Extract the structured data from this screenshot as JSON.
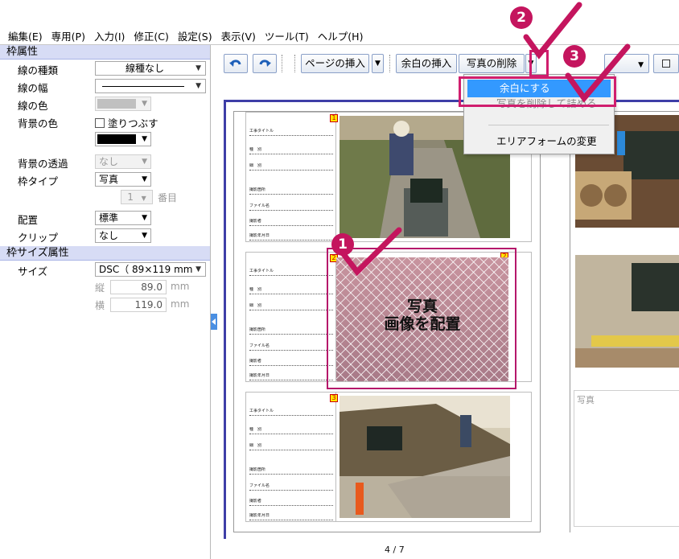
{
  "menubar": [
    {
      "id": "edit",
      "label": "編集(E)"
    },
    {
      "id": "special",
      "label": "専用(P)"
    },
    {
      "id": "input",
      "label": "入力(I)"
    },
    {
      "id": "modify",
      "label": "修正(C)"
    },
    {
      "id": "settings",
      "label": "設定(S)"
    },
    {
      "id": "view",
      "label": "表示(V)"
    },
    {
      "id": "tools",
      "label": "ツール(T)"
    },
    {
      "id": "help",
      "label": "ヘルプ(H)"
    }
  ],
  "frame_props": {
    "header": "枠属性",
    "line_type_label": "線の種類",
    "line_type_value": "線種なし",
    "line_width_label": "線の幅",
    "line_color_label": "線の色",
    "bg_color_label": "背景の色",
    "fill_label": "塗りつぶす",
    "bg_transparency_label": "背景の透過",
    "bg_transparency_value": "なし",
    "frame_type_label": "枠タイプ",
    "frame_type_value": "写真",
    "index_value": "1",
    "index_suffix": "番目",
    "layout_label": "配置",
    "layout_value": "標準",
    "clip_label": "クリップ",
    "clip_value": "なし"
  },
  "size_props": {
    "header": "枠サイズ属性",
    "size_label": "サイズ",
    "size_value": "DSC（ 89×119 mm",
    "height_label": "縦",
    "height_value": "89.0",
    "height_unit": "mm",
    "width_label": "横",
    "width_value": "119.0",
    "width_unit": "mm"
  },
  "toolbar": {
    "insert_page": "ページの挿入",
    "insert_blank": "余白の挿入",
    "delete_photo": "写真の削除"
  },
  "popup": {
    "make_blank": "余白にする",
    "move_photo": "写真を削除して詰める",
    "change_area_form": "エリアフォームの変更"
  },
  "overlay": {
    "line1": "写真",
    "line2": "画像を配置"
  },
  "slots": [
    {
      "num": "1",
      "rows": [
        "工事タイトル",
        "種　別",
        "細　別",
        "撮影箇所",
        "ファイル名",
        "撮影者",
        "撮影年月日"
      ]
    },
    {
      "num": "2",
      "rows": [
        "工事タイトル",
        "種　別",
        "細　別",
        "撮影箇所",
        "ファイル名",
        "撮影者",
        "撮影年月日"
      ]
    },
    {
      "num": "3",
      "rows": [
        "工事タイトル",
        "種　別",
        "細　別",
        "撮影箇所",
        "ファイル名",
        "撮影者",
        "撮影年月日"
      ]
    }
  ],
  "right_page": {
    "empty_slot_label": "写真"
  },
  "callouts": {
    "one": "1",
    "two": "2",
    "three": "3"
  },
  "page_indicator": "4 / 7",
  "colors": {
    "accent": "#c4155e",
    "highlight": "#3399ff",
    "panel_header": "#d7dcf5",
    "frame_border": "#3e3ea7"
  }
}
